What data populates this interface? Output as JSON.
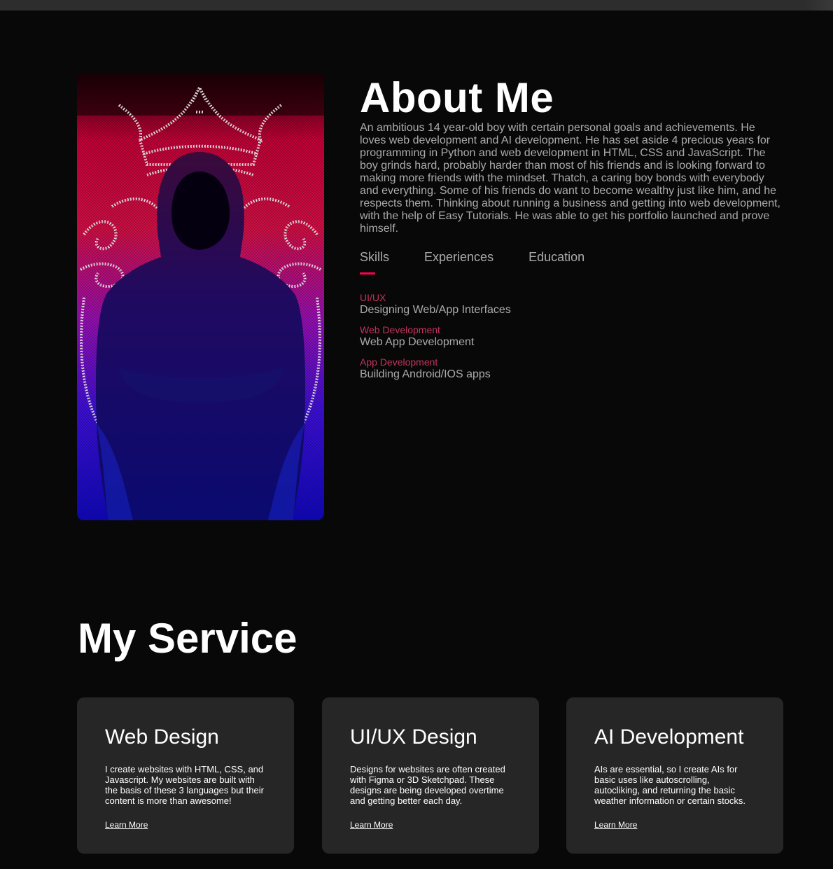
{
  "about": {
    "title": "About Me",
    "bio": "An ambitious 14 year-old boy with certain personal goals and achievements. He loves web development and AI development. He has set aside 4 precious years for programming in Python and web development in HTML, CSS and JavaScript. The boy grinds hard, probably harder than most of his friends and is looking forward to making more friends with the mindset. Thatch, a caring boy bonds with everybody and everything. Some of his friends do want to become wealthy just like him, and he respects them. Thinking about running a business and getting into web development, with the help of Easy Tutorials. He was able to get his portfolio launched and prove himself.",
    "tabs": [
      {
        "label": "Skills",
        "active": true
      },
      {
        "label": "Experiences",
        "active": false
      },
      {
        "label": "Education",
        "active": false
      }
    ],
    "skills": [
      {
        "name": "UI/UX",
        "desc": "Designing Web/App Interfaces"
      },
      {
        "name": "Web Development",
        "desc": "Web App Development"
      },
      {
        "name": "App Development",
        "desc": "Building Android/IOS apps"
      }
    ]
  },
  "services": {
    "title": "My Service",
    "cards": [
      {
        "title": "Web Design",
        "text": "I create websites with HTML, CSS, and Javascript. My websites are built with the basis of these 3 languages but their content is more than awesome!",
        "link": "Learn More"
      },
      {
        "title": "UI/UX Design",
        "text": "Designs for websites are often created with Figma or 3D Sketchpad. These designs are being developed overtime and getting better each day.",
        "link": "Learn More"
      },
      {
        "title": "AI Development",
        "text": "AIs are essential, so I create AIs for basic uses like autoscrolling, autocliking, and returning the basic weather information or certain stocks.",
        "link": "Learn More"
      }
    ]
  },
  "colors": {
    "background": "#080808",
    "accent": "#ff004f",
    "skill_label": "#c2335e",
    "muted_text": "#ababab",
    "card": "#262626"
  }
}
